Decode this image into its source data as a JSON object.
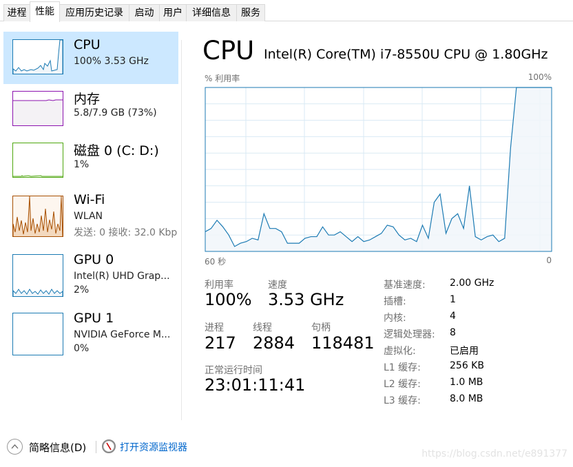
{
  "tabs": [
    "进程",
    "性能",
    "应用历史记录",
    "启动",
    "用户",
    "详细信息",
    "服务"
  ],
  "selected_tab": "性能",
  "sidebar": {
    "items": [
      {
        "title": "CPU",
        "sub": "100% 3.53 GHz",
        "color": "#1b7ab3",
        "selected": true
      },
      {
        "title": "内存",
        "sub": "5.8/7.9 GB (73%)",
        "color": "#8b12ae"
      },
      {
        "title": "磁盘 0 (C: D:)",
        "sub": "1%",
        "color": "#4da60c"
      },
      {
        "title": "Wi-Fi",
        "sub": "WLAN",
        "sub2": "发送: 0 接收: 32.0 Kbp",
        "color": "#a74f01"
      },
      {
        "title": "GPU 0",
        "sub": "Intel(R) UHD Grap...",
        "sub2": "2%",
        "color": "#1b7ab3"
      },
      {
        "title": "GPU 1",
        "sub": "NVIDIA GeForce M...",
        "sub2": "0%",
        "color": "#1b7ab3"
      }
    ]
  },
  "main": {
    "title": "CPU",
    "model": "Intel(R) Core(TM) i7-8550U CPU @ 1.80GHz",
    "chart_top_left": "% 利用率",
    "chart_top_right": "100%",
    "chart_bottom_left": "60 秒",
    "chart_bottom_right": "0",
    "stats": {
      "util_label": "利用率",
      "util": "100%",
      "speed_label": "速度",
      "speed": "3.53 GHz",
      "proc_label": "进程",
      "proc": "217",
      "thread_label": "线程",
      "thread": "2884",
      "handle_label": "句柄",
      "handle": "118481",
      "uptime_label": "正常运行时间",
      "uptime": "23:01:11:41"
    },
    "specs": [
      {
        "k": "基准速度:",
        "v": "2.00 GHz"
      },
      {
        "k": "插槽:",
        "v": "1"
      },
      {
        "k": "内核:",
        "v": "4"
      },
      {
        "k": "逻辑处理器:",
        "v": "8"
      },
      {
        "k": "虚拟化:",
        "v": "已启用"
      },
      {
        "k": "L1 缓存:",
        "v": "256 KB"
      },
      {
        "k": "L2 缓存:",
        "v": "1.0 MB"
      },
      {
        "k": "L3 缓存:",
        "v": "8.0 MB"
      }
    ]
  },
  "chart_data": {
    "type": "area",
    "xlabel_left": "60 秒",
    "xlabel_right": "0",
    "ylabel": "% 利用率",
    "ymax_label": "100%",
    "ylim": [
      0,
      100
    ],
    "xlim": [
      60,
      0
    ],
    "grid": true,
    "color": "#1b7ab3",
    "values": [
      12,
      14,
      19,
      15,
      10,
      3,
      5,
      6,
      8,
      7,
      23,
      14,
      14,
      12,
      5,
      5,
      5,
      8,
      9,
      9,
      15,
      10,
      10,
      12,
      9,
      6,
      9,
      6,
      7,
      9,
      11,
      16,
      15,
      10,
      7,
      8,
      6,
      16,
      8,
      30,
      35,
      11,
      20,
      23,
      14,
      40,
      9,
      7,
      9,
      10,
      6,
      8,
      63,
      100,
      100,
      100,
      100,
      100,
      100,
      100
    ]
  },
  "footer": {
    "brief": "简略信息(D)",
    "monitor": "打开资源监视器",
    "watermark": "https://blog.csdn.net/e891377"
  }
}
